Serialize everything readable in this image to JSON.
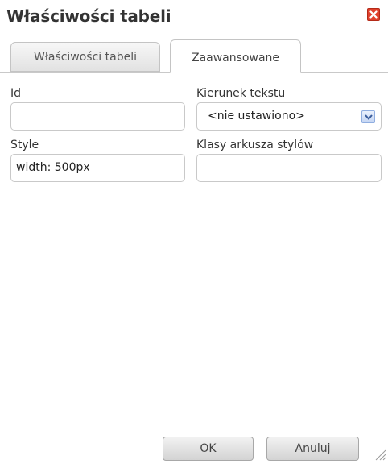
{
  "dialog": {
    "title": "Właściwości tabeli",
    "close_icon": "close-icon",
    "accent_color": "#e0402c"
  },
  "tabs": [
    {
      "label": "Właściwości tabeli",
      "active": false
    },
    {
      "label": "Zaawansowane",
      "active": true
    }
  ],
  "fields": {
    "id": {
      "label": "Id",
      "value": ""
    },
    "text_direction": {
      "label": "Kierunek tekstu",
      "value": "<nie ustawiono>"
    },
    "style": {
      "label": "Style",
      "value": "width: 500px"
    },
    "stylesheet_classes": {
      "label": "Klasy arkusza stylów",
      "value": ""
    }
  },
  "footer": {
    "ok_label": "OK",
    "cancel_label": "Anuluj"
  }
}
